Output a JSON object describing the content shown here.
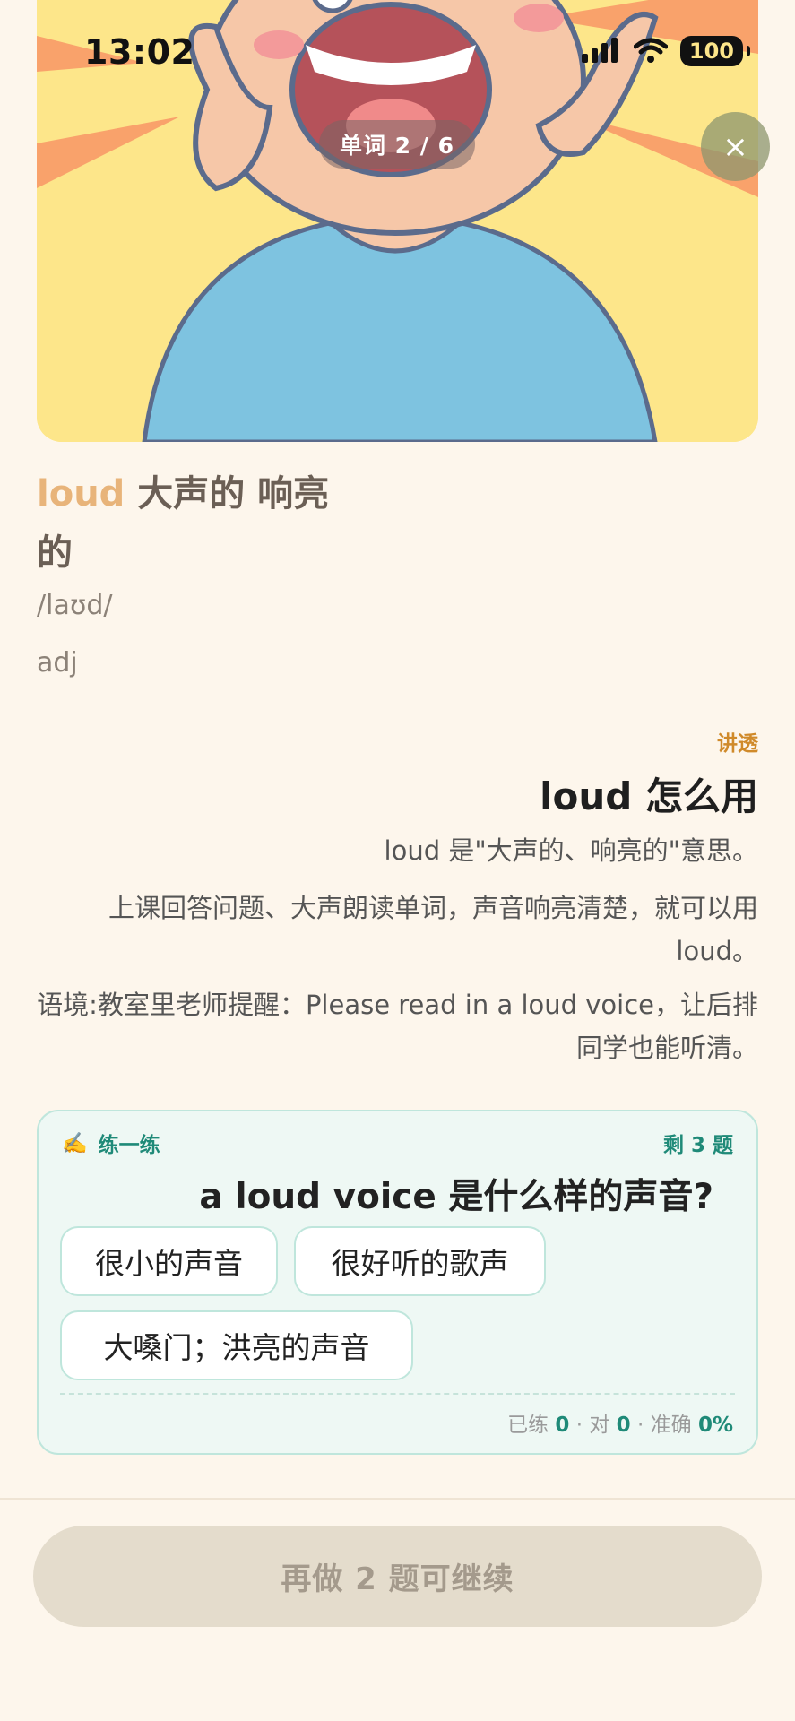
{
  "status_bar": {
    "time": "13:02",
    "battery": "100"
  },
  "header": {
    "progress": "单词 2 / 6",
    "close_symbol": "×"
  },
  "word": {
    "english": "loud",
    "meaning": "大声的 响亮的",
    "phonetic": "/laʊd/",
    "part_of_speech": "adj"
  },
  "explain": {
    "tag": "讲透",
    "heading": "loud 怎么用",
    "paragraphs": [
      "loud 是\"大声的、响亮的\"意思。",
      "上课回答问题、大声朗读单词，声音响亮清楚，就可以用 loud。",
      "语境:教室里老师提醒：Please read in a loud voice，让后排同学也能听清。"
    ]
  },
  "practice": {
    "icon": "✍️",
    "title": "练一练",
    "remaining": "剩 3 题",
    "question": "a loud voice 是什么样的声音?",
    "options": [
      "很小的声音",
      "很好听的歌声",
      "大嗓门；洪亮的声音"
    ],
    "stats": {
      "practiced_label": "已练",
      "practiced": "0",
      "correct_label": "对",
      "correct": "0",
      "accuracy_label": "准确",
      "accuracy": "0%"
    }
  },
  "footer": {
    "button_label": "再做 2 题可继续"
  }
}
